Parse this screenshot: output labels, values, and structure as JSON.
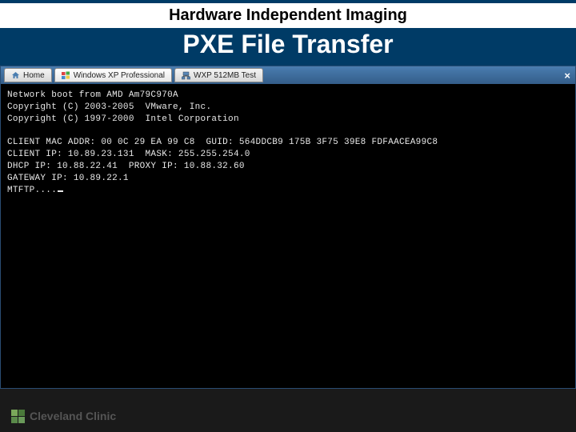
{
  "header": {
    "topline": "Hardware Independent Imaging",
    "title": "PXE File Transfer"
  },
  "tabs": [
    {
      "icon": "home-icon",
      "label": "Home"
    },
    {
      "icon": "windows-icon",
      "label": "Windows XP Professional",
      "active": true
    },
    {
      "icon": "node-icon",
      "label": "WXP 512MB Test"
    }
  ],
  "closeLabel": "×",
  "console": {
    "lines": [
      "Network boot from AMD Am79C970A",
      "Copyright (C) 2003-2005  VMware, Inc.",
      "Copyright (C) 1997-2000  Intel Corporation",
      "",
      "CLIENT MAC ADDR: 00 0C 29 EA 99 C8  GUID: 564DDCB9 175B 3F75 39E8 FDFAACEA99C8",
      "CLIENT IP: 10.89.23.131  MASK: 255.255.254.0",
      "DHCP IP: 10.88.22.41  PROXY IP: 10.88.32.60",
      "GATEWAY IP: 10.89.22.1",
      "MTFTP...."
    ]
  },
  "footer": {
    "brand": "Cleveland Clinic"
  }
}
